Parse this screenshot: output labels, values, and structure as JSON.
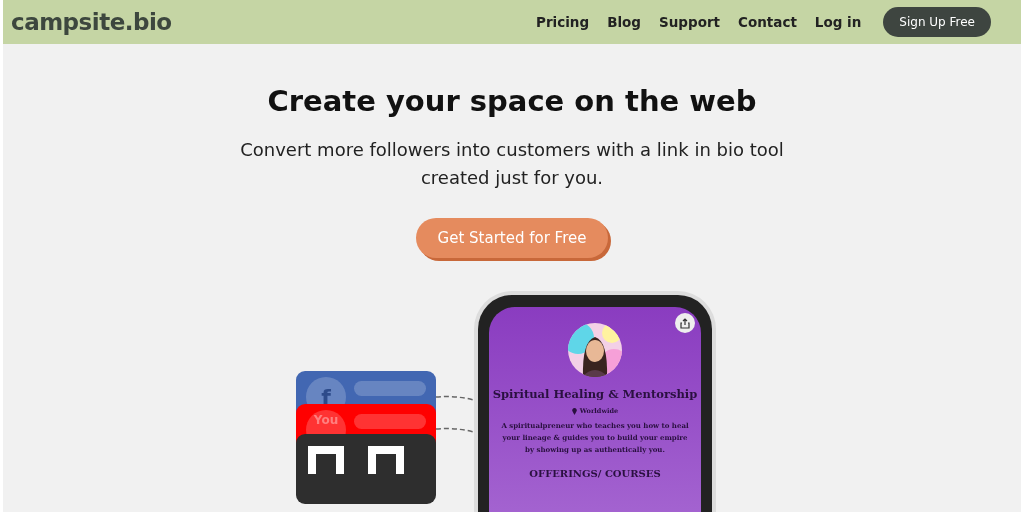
{
  "header": {
    "logo": "campsite.bio",
    "nav": [
      "Pricing",
      "Blog",
      "Support",
      "Contact",
      "Log in"
    ],
    "cta": "Sign Up Free"
  },
  "hero": {
    "title": "Create your space on the web",
    "subtitle": "Convert more followers into customers with a link in bio tool created just for you.",
    "button": "Get Started for Free"
  },
  "phone": {
    "title": "Spiritual Healing & Mentorship",
    "location": "Worldwide",
    "bio": "A spiritualpreneur who teaches you how to heal your lineage & guides you to build your empire by showing up as authentically you.",
    "section": "OFFERINGS/ COURSES"
  },
  "cards": [
    {
      "kind": "facebook",
      "glyph": "f",
      "color": "#4267b2"
    },
    {
      "kind": "youtube",
      "glyph": "You",
      "color": "#ff0000"
    },
    {
      "kind": "qr",
      "color": "#2e2e2e"
    }
  ]
}
